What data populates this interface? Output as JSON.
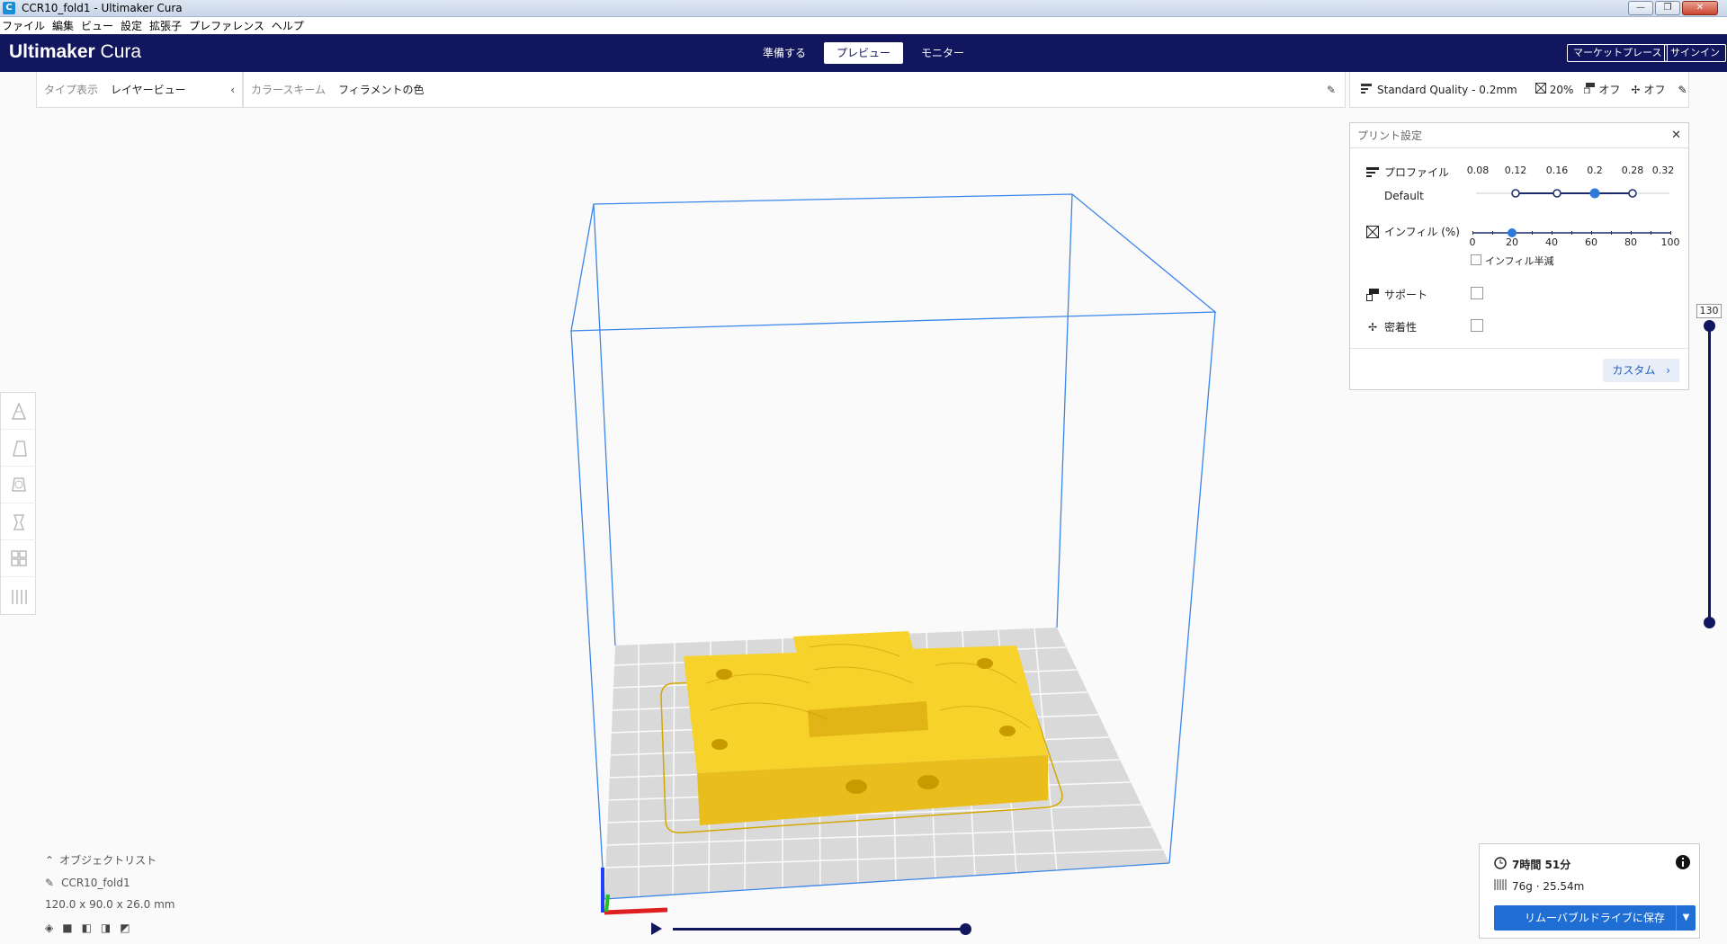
{
  "window": {
    "title": "CCR10_fold1 - Ultimaker Cura",
    "app_icon": "C",
    "minimize": "—",
    "restore": "❐",
    "close": "✕"
  },
  "menu": [
    "ファイル",
    "編集",
    "ビュー",
    "設定",
    "拡張子",
    "プレファレンス",
    "ヘルプ"
  ],
  "header": {
    "logo_bold": "Ultimaker",
    "logo_light": " Cura",
    "stages": [
      "準備する",
      "プレビュー",
      "モニター"
    ],
    "active_stage": "プレビュー",
    "marketplace": "マーケットプレース",
    "signin": "サインイン"
  },
  "viewbar": {
    "type_label": "タイプ表示",
    "type_value": "レイヤービュー",
    "color_label": "カラースキーム",
    "color_value": "フィラメントの色"
  },
  "quality_bar": {
    "profile": "Standard Quality - 0.2mm",
    "infill": "20%",
    "support": "オフ",
    "adhesion": "オフ"
  },
  "print_settings": {
    "title": "プリント設定",
    "profile_label": "プロファイル",
    "profile_name": "Default",
    "layer_heights": [
      "0.08",
      "0.12",
      "0.16",
      "0.2",
      "0.28",
      "0.32"
    ],
    "selected_layer_height": "0.2",
    "infill_label": "インフィル (%)",
    "infill_ticks": [
      "0",
      "20",
      "40",
      "60",
      "80",
      "100"
    ],
    "infill_value": 20,
    "gradual_label": "インフィル半減",
    "support_label": "サポート",
    "adhesion_label": "密着性",
    "custom_button": "カスタム"
  },
  "layer_slider": {
    "current": "130"
  },
  "object_list": {
    "title": "オブジェクトリスト",
    "object": "CCR10_fold1",
    "dimensions": "120.0 x 90.0 x 26.0 mm"
  },
  "job": {
    "time": "7時間 51分",
    "material": "76g · 25.54m",
    "save_button": "リムーバブルドライブに保存"
  },
  "icons": {
    "clock": "clock-icon",
    "info": "info-icon",
    "spool": "filament-spool-icon",
    "play": "play-icon"
  },
  "colors": {
    "header": "#12165e",
    "accent": "#1f6ed4",
    "model": "#f7d22a",
    "build_volume": "#3a86e8"
  }
}
